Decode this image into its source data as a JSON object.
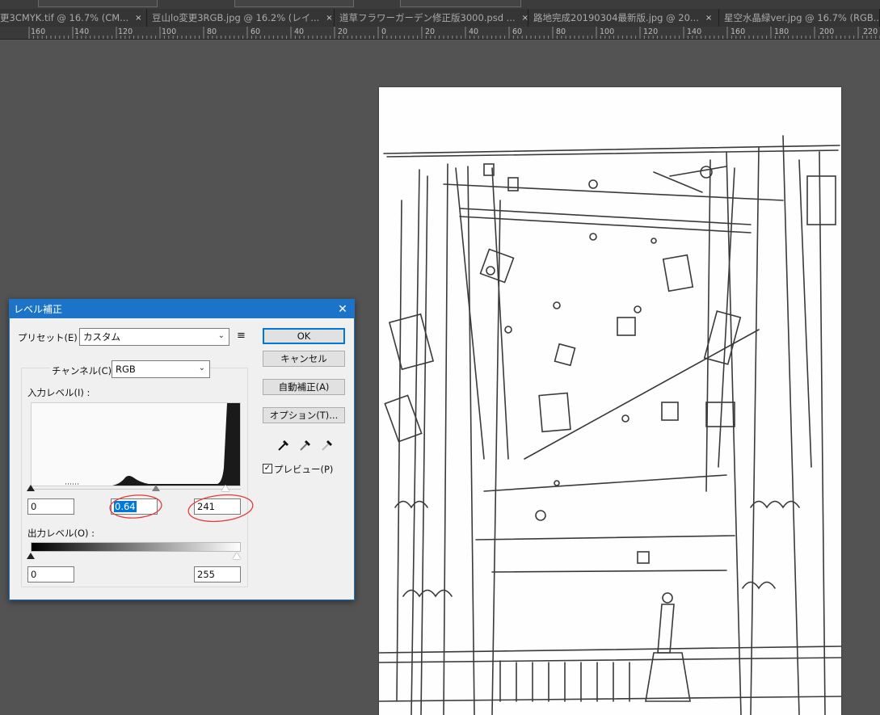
{
  "tabs": [
    {
      "label": "更3CMYK.tif @ 16.7% (CM..."
    },
    {
      "label": "豆山lo変更3RGB.jpg @ 16.2% (レイ..."
    },
    {
      "label": "道草フラワーガーデン修正版3000.psd ..."
    },
    {
      "label": "路地完成20190304最新版.jpg @ 20..."
    },
    {
      "label": "星空水晶緑ver.jpg @ 16.7% (RGB..."
    }
  ],
  "tab_close": "×",
  "ruler_labels": [
    "160",
    "140",
    "120",
    "100",
    "80",
    "60",
    "40",
    "20",
    "0",
    "20",
    "40",
    "60",
    "80",
    "100",
    "120",
    "140",
    "160",
    "180",
    "200",
    "220"
  ],
  "dialog": {
    "title": "レベル補正",
    "close": "✕",
    "preset_label": "プリセット(E) :",
    "preset_value": "カスタム",
    "channel_label": "チャンネル(C) :",
    "channel_value": "RGB",
    "input_levels_label": "入力レベル(I) :",
    "input_black": "0",
    "input_gamma": "0.64",
    "input_white": "241",
    "output_levels_label": "出力レベル(O) :",
    "output_black": "0",
    "output_white": "255",
    "ok": "OK",
    "cancel": "キャンセル",
    "auto": "自動補正(A)",
    "options": "オプション(T)...",
    "preview_label": "プレビュー(P)",
    "preview_checked": true
  },
  "colors": {
    "accent": "#1c74c8",
    "annotation": "#e03c3c",
    "workspace": "#535353"
  }
}
